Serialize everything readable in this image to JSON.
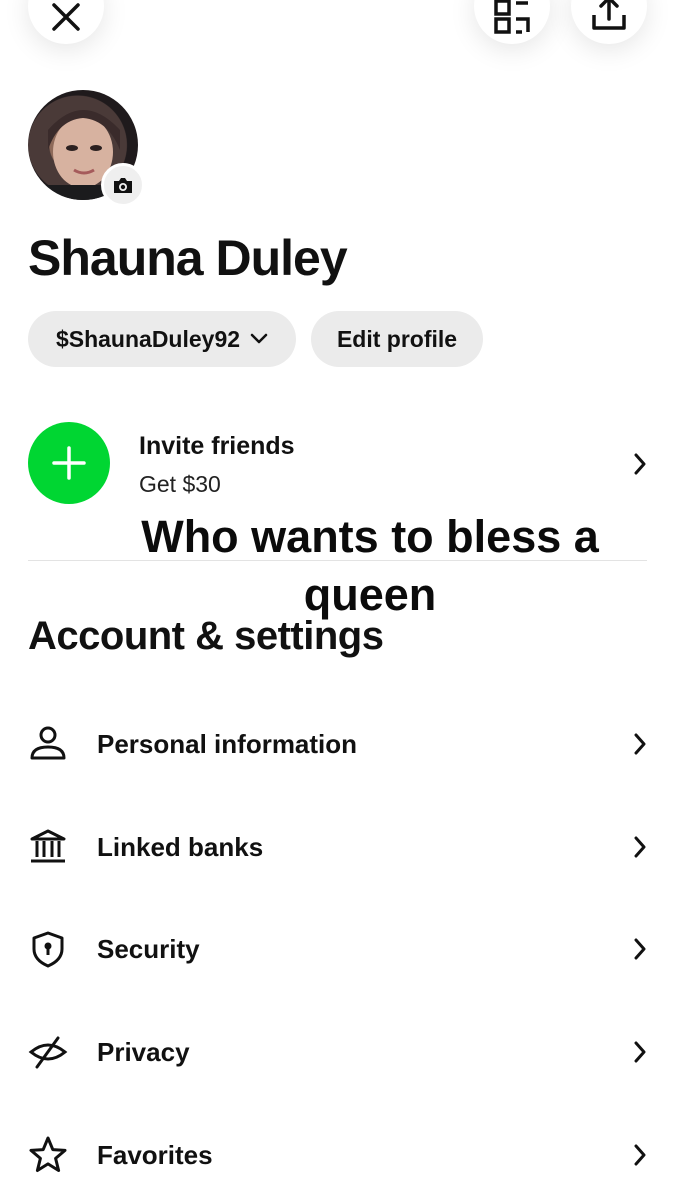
{
  "profile": {
    "name": "Shauna Duley",
    "cashtag": "$ShaunaDuley92",
    "edit_label": "Edit profile"
  },
  "invite": {
    "title": "Invite friends",
    "subtitle": "Get $30"
  },
  "overlay": {
    "line1": "Who wants to bless a",
    "line2": "queen"
  },
  "account": {
    "title": "Account & settings",
    "items": [
      {
        "label": "Personal information",
        "icon": "person-icon"
      },
      {
        "label": "Linked banks",
        "icon": "bank-icon"
      },
      {
        "label": "Security",
        "icon": "shield-lock-icon"
      },
      {
        "label": "Privacy",
        "icon": "eye-slash-icon"
      },
      {
        "label": "Favorites",
        "icon": "star-icon"
      }
    ]
  },
  "colors": {
    "accent_green": "#00d632",
    "pill_bg": "#ebebeb",
    "text": "#111111"
  }
}
